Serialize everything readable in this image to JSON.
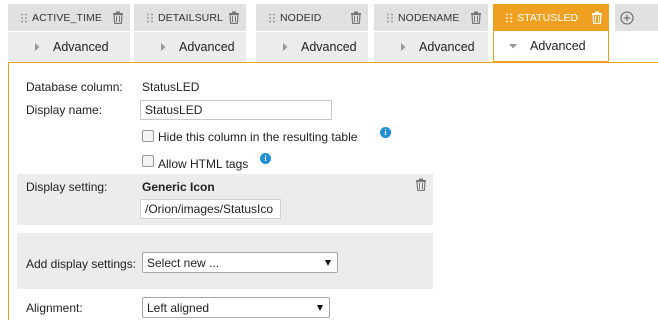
{
  "columns": [
    {
      "name": "ACTIVE_TIME",
      "advanced_label": "Advanced",
      "active": false
    },
    {
      "name": "DETAILSURL",
      "advanced_label": "Advanced",
      "active": false
    },
    {
      "name": "NODEID",
      "advanced_label": "Advanced",
      "active": false
    },
    {
      "name": "NODENAME",
      "advanced_label": "Advanced",
      "active": false
    },
    {
      "name": "STATUSLED",
      "advanced_label": "Advanced",
      "active": true
    }
  ],
  "colors": {
    "accent": "#f0a020",
    "tab_bg": "#e1e1e1",
    "info": "#1f8fd6"
  },
  "panel": {
    "database_column_label": "Database column:",
    "database_column_value": "StatusLED",
    "display_name_label": "Display name:",
    "display_name_value": "StatusLED",
    "hide_column_label": "Hide this column in the resulting table",
    "hide_column_checked": false,
    "allow_html_label": "Allow HTML tags",
    "allow_html_checked": false,
    "display_setting_label": "Display setting:",
    "display_setting_title": "Generic Icon",
    "display_setting_path": "/Orion/images/StatusIco",
    "add_display_settings_label": "Add display settings:",
    "add_display_settings_selected": "Select new ...",
    "alignment_label": "Alignment:",
    "alignment_selected": "Left aligned"
  }
}
